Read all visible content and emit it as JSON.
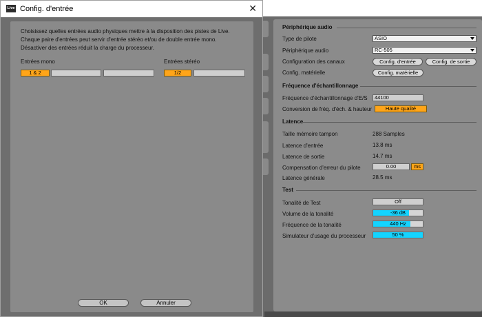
{
  "dialog": {
    "logo": "Live",
    "title": "Config. d'entrée",
    "close": "✕",
    "description": [
      "Choisissez quelles entrées audio physiques mettre à la disposition des pistes de Live.",
      "Chaque paire d'entrées peut servir d'entrée stéréo et/ou de double entrée mono.",
      "Désactiver des entrées réduit la charge du processeur."
    ],
    "mono_title": "Entrées mono",
    "mono_channels": [
      {
        "label": "1 & 2",
        "active": true
      },
      {
        "label": "",
        "active": false
      },
      {
        "label": "",
        "active": false
      }
    ],
    "stereo_title": "Entrées stéréo",
    "stereo_channels": [
      {
        "label": "1/2",
        "active": true
      },
      {
        "label": "",
        "active": false
      }
    ],
    "ok": "OK",
    "cancel": "Annuler"
  },
  "prefs": {
    "audio_device": {
      "title": "Périphérique audio",
      "driver_type_label": "Type de pilote",
      "driver_type_value": "ASIO",
      "audio_device_label": "Périphérique audio",
      "audio_device_value": "RC-505",
      "channel_config_label": "Configuration des canaux",
      "input_config_button": "Config. d'entrée",
      "output_config_button": "Config. de sortie",
      "hardware_config_label": "Config. matérielle",
      "hardware_config_button": "Config. matérielle"
    },
    "sample_rate": {
      "title": "Fréquence d'échantillonnage",
      "io_rate_label": "Fréquence d'échantillonnage d'E/S",
      "io_rate_value": "44100",
      "conversion_label": "Conversion de fréq. d'éch. & hauteur",
      "conversion_value": "Haute qualité"
    },
    "latency": {
      "title": "Latence",
      "buffer_label": "Taille mémoire tampon",
      "buffer_value": "288 Samples",
      "input_latency_label": "Latence d'entrée",
      "input_latency_value": "13.8 ms",
      "output_latency_label": "Latence de sortie",
      "output_latency_value": "14.7 ms",
      "driver_comp_label": "Compensation d'erreur du pilote",
      "driver_comp_value": "0.00",
      "driver_comp_unit": "ms",
      "overall_latency_label": "Latence générale",
      "overall_latency_value": "28.5 ms"
    },
    "test": {
      "title": "Test",
      "test_tone_label": "Tonalité de Test",
      "test_tone_value": "Off",
      "tone_volume_label": "Volume de la tonalité",
      "tone_volume_value": "-36 dB",
      "tone_volume_level": 0.72,
      "tone_freq_label": "Fréquence de la tonalité",
      "tone_freq_value": "440 Hz",
      "tone_freq_level": 0.75,
      "cpu_sim_label": "Simulateur d'usage du processeur",
      "cpu_sim_value": "50 %",
      "cpu_sim_level": 1.0
    }
  },
  "colors": {
    "accent_orange": "#ffa519",
    "accent_cyan": "#14d4ff",
    "panel": "#8a8a8a"
  }
}
